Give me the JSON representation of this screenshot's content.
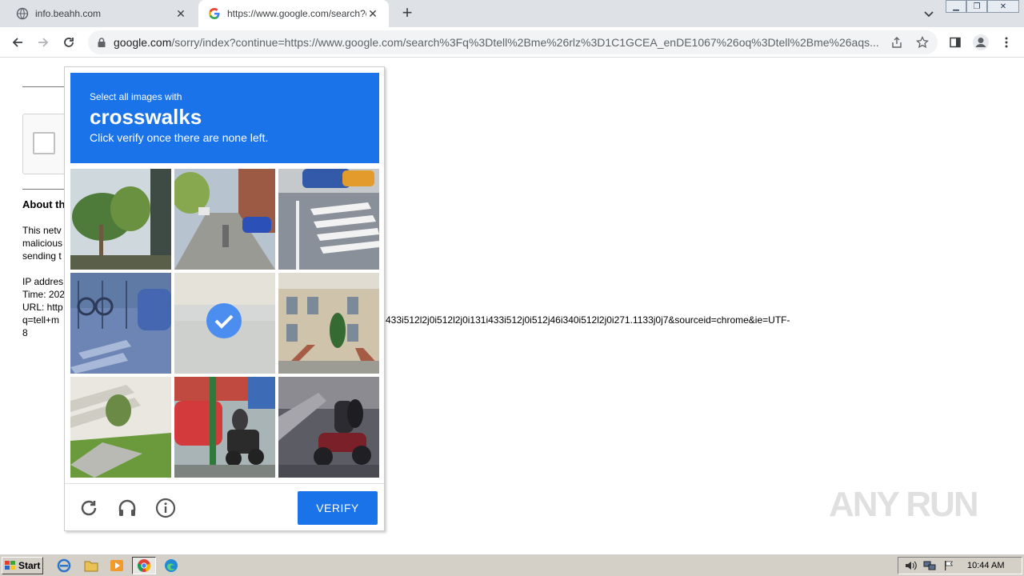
{
  "browser": {
    "tabs": [
      {
        "title": "info.beahh.com",
        "active": false
      },
      {
        "title": "https://www.google.com/search?q=",
        "active": true
      }
    ],
    "address": {
      "host": "google.com",
      "path": "/sorry/index?continue=https://www.google.com/search%3Fq%3Dtell%2Bme%26rlz%3D1C1GCEA_enDE1067%26oq%3Dtell%2Bme%26aqs..."
    }
  },
  "page": {
    "about_heading": "About th",
    "para_lines": [
      "This netv",
      "malicious",
      "sending t"
    ],
    "ip_line": "IP addres",
    "time_line": "Time: 202",
    "url_line": "URL: http",
    "q_line": "q=tell+m",
    "url_tail": "433i512l2j0i512l2j0i131i433i512j0i512j46i340i512l2j0i271.1133j0j7&sourceid=chrome&ie=UTF-",
    "url_tail2": "8"
  },
  "captcha": {
    "instruction": "Select all images with",
    "target": "crosswalks",
    "hint": "Click verify once there are none left.",
    "selected_tile": 4,
    "verify_label": "VERIFY"
  },
  "watermark": "ANY RUN",
  "taskbar": {
    "start_label": "Start",
    "clock": "10:44 AM"
  },
  "colors": {
    "accent": "#1a73e8",
    "tabstrip": "#dee1e6",
    "taskbar": "#d4d0c8"
  }
}
